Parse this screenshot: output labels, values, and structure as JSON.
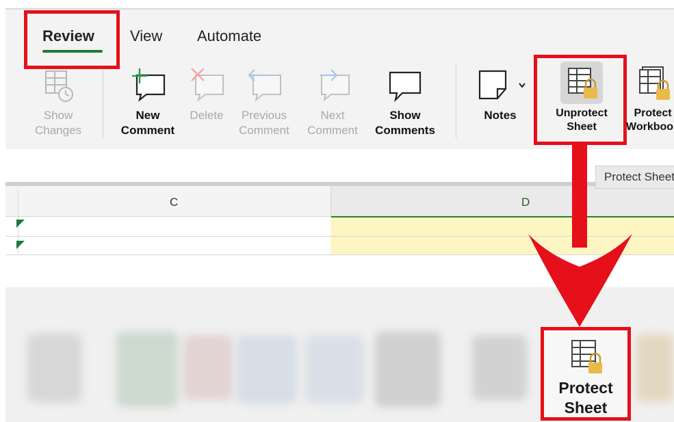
{
  "tabs": [
    {
      "label": "Review"
    },
    {
      "label": "View"
    },
    {
      "label": "Automate"
    }
  ],
  "ribbon": {
    "show_changes": {
      "line1": "Show",
      "line2": "Changes"
    },
    "new_comment": {
      "line1": "New",
      "line2": "Comment"
    },
    "delete": {
      "line1": "Delete"
    },
    "previous_comment": {
      "line1": "Previous",
      "line2": "Comment"
    },
    "next_comment": {
      "line1": "Next",
      "line2": "Comment"
    },
    "show_comments": {
      "line1": "Show",
      "line2": "Comments"
    },
    "notes": {
      "line1": "Notes"
    },
    "unprotect_sheet": {
      "line1": "Unprotect",
      "line2": "Sheet"
    },
    "protect_workbook": {
      "line1": "Protect",
      "line2": "Workbook"
    }
  },
  "tooltip": "Protect Sheet",
  "columns": [
    "C",
    "D"
  ],
  "callout": {
    "line1": "Protect",
    "line2": "Sheet"
  },
  "colors": {
    "highlight_red": "#e5101a",
    "tab_underline_green": "#1e7a3c",
    "lock_gold": "#e9b949",
    "selected_cell_yellow": "#fdf6c3"
  }
}
